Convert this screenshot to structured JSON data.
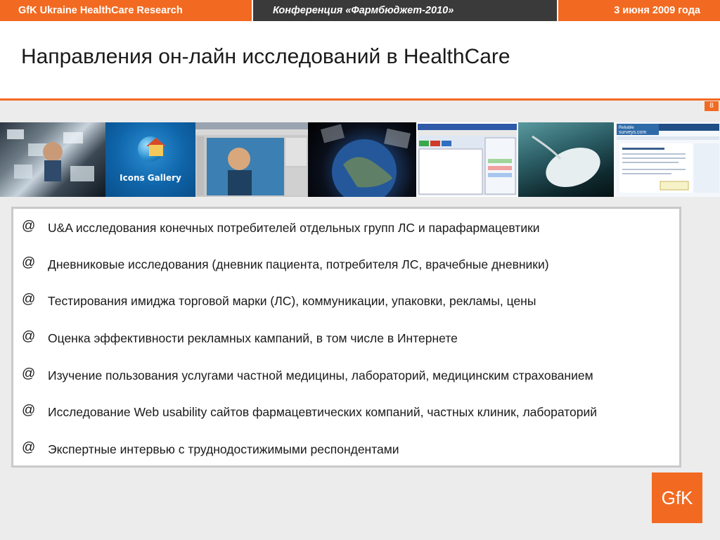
{
  "header": {
    "left": "GfK Ukraine HealthCare Research",
    "center": "Конференция «Фармбюджет-2010»",
    "right": "3 июня 2009 года"
  },
  "title": "Направления он-лайн исследований в HealthCare",
  "page_number": "8",
  "image_strip": {
    "icons_gallery_label": "Icons Gallery",
    "surveys_site_logo": "Reliable surveys.com"
  },
  "bullets": {
    "marker": "@",
    "items": [
      "U&A исследования конечных потребителей отдельных групп ЛС и парафармацевтики",
      "Дневниковые исследования (дневник пациента, потребителя ЛС, врачебные дневники)",
      "Тестирования имиджа торговой марки (ЛС), коммуникации, упаковки, рекламы, цены",
      "Оценка эффективности рекламных кампаний, в том числе в Интернете",
      "Изучение пользования услугами частной медицины, лабораторий, медицинским страхованием",
      "Исследование Web usability сайтов фармацевтических компаний, частных клиник, лабораторий",
      "Экспертные интервью с труднодостижимыми респондентами"
    ]
  },
  "logo": "GfK",
  "colors": {
    "brand_orange": "#f26a21",
    "dark_bar": "#3a3a3a",
    "box_border": "#c9c9c9"
  }
}
